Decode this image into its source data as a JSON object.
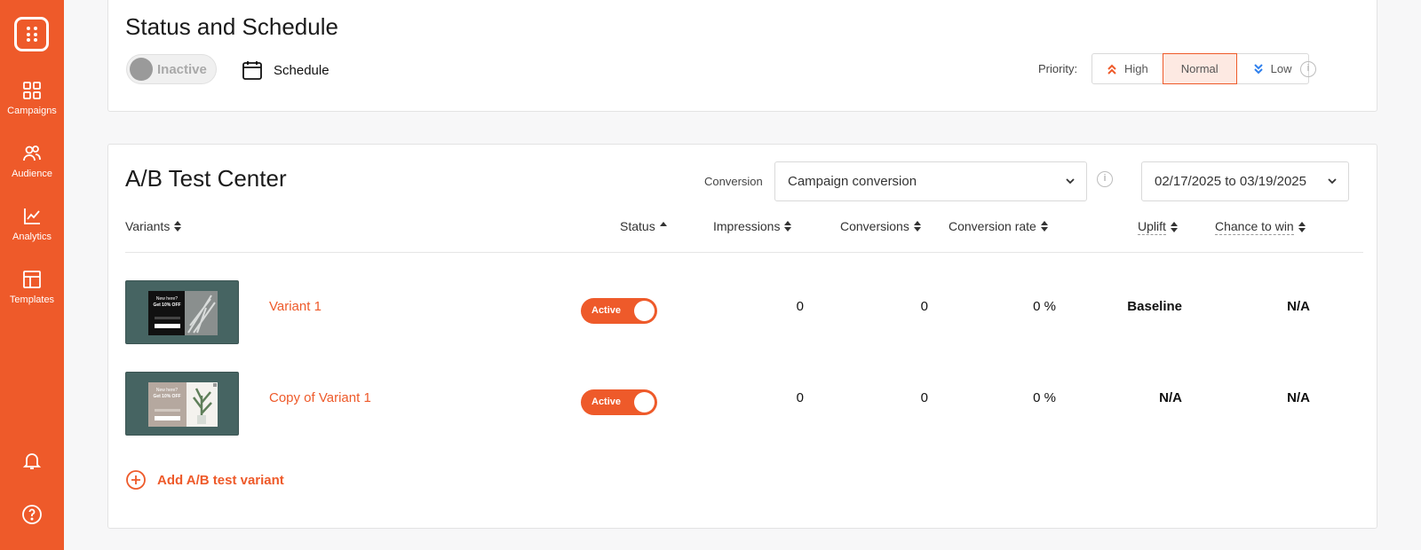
{
  "sidebar": {
    "items": [
      {
        "label": "Campaigns",
        "icon": "grid-icon"
      },
      {
        "label": "Audience",
        "icon": "users-icon"
      },
      {
        "label": "Analytics",
        "icon": "chart-icon"
      },
      {
        "label": "Templates",
        "icon": "layout-icon"
      }
    ],
    "bottom_icons": [
      "bell-icon",
      "help-icon"
    ]
  },
  "status_card": {
    "title": "Status and Schedule",
    "toggle_label": "Inactive",
    "schedule_label": "Schedule",
    "priority_label": "Priority:",
    "priority_options": [
      "High",
      "Normal",
      "Low"
    ],
    "priority_selected": "Normal"
  },
  "ab_card": {
    "title": "A/B Test Center",
    "conversion_label": "Conversion",
    "conversion_value": "Campaign conversion",
    "date_range": "02/17/2025 to 03/19/2025",
    "columns": {
      "variants": "Variants",
      "status": "Status",
      "impressions": "Impressions",
      "conversions": "Conversions",
      "conversion_rate": "Conversion rate",
      "uplift": "Uplift",
      "chance_to_win": "Chance to win"
    },
    "rows": [
      {
        "name": "Variant 1",
        "status": "Active",
        "impressions": "0",
        "conversions": "0",
        "conversion_rate": "0 %",
        "uplift": "Baseline",
        "chance_to_win": "N/A"
      },
      {
        "name": "Copy of Variant 1",
        "status": "Active",
        "impressions": "0",
        "conversions": "0",
        "conversion_rate": "0 %",
        "uplift": "N/A",
        "chance_to_win": "N/A"
      }
    ],
    "add_label": "Add A/B test variant"
  },
  "thumb_1": {
    "headline": "New here?",
    "offer": "Get 10% OFF"
  },
  "thumb_2": {
    "headline": "New here?",
    "offer": "Get 10% OFF"
  },
  "colors": {
    "accent": "#ee5a2a",
    "selected_bg": "#fde9e2",
    "thumb_bg": "#466462"
  }
}
